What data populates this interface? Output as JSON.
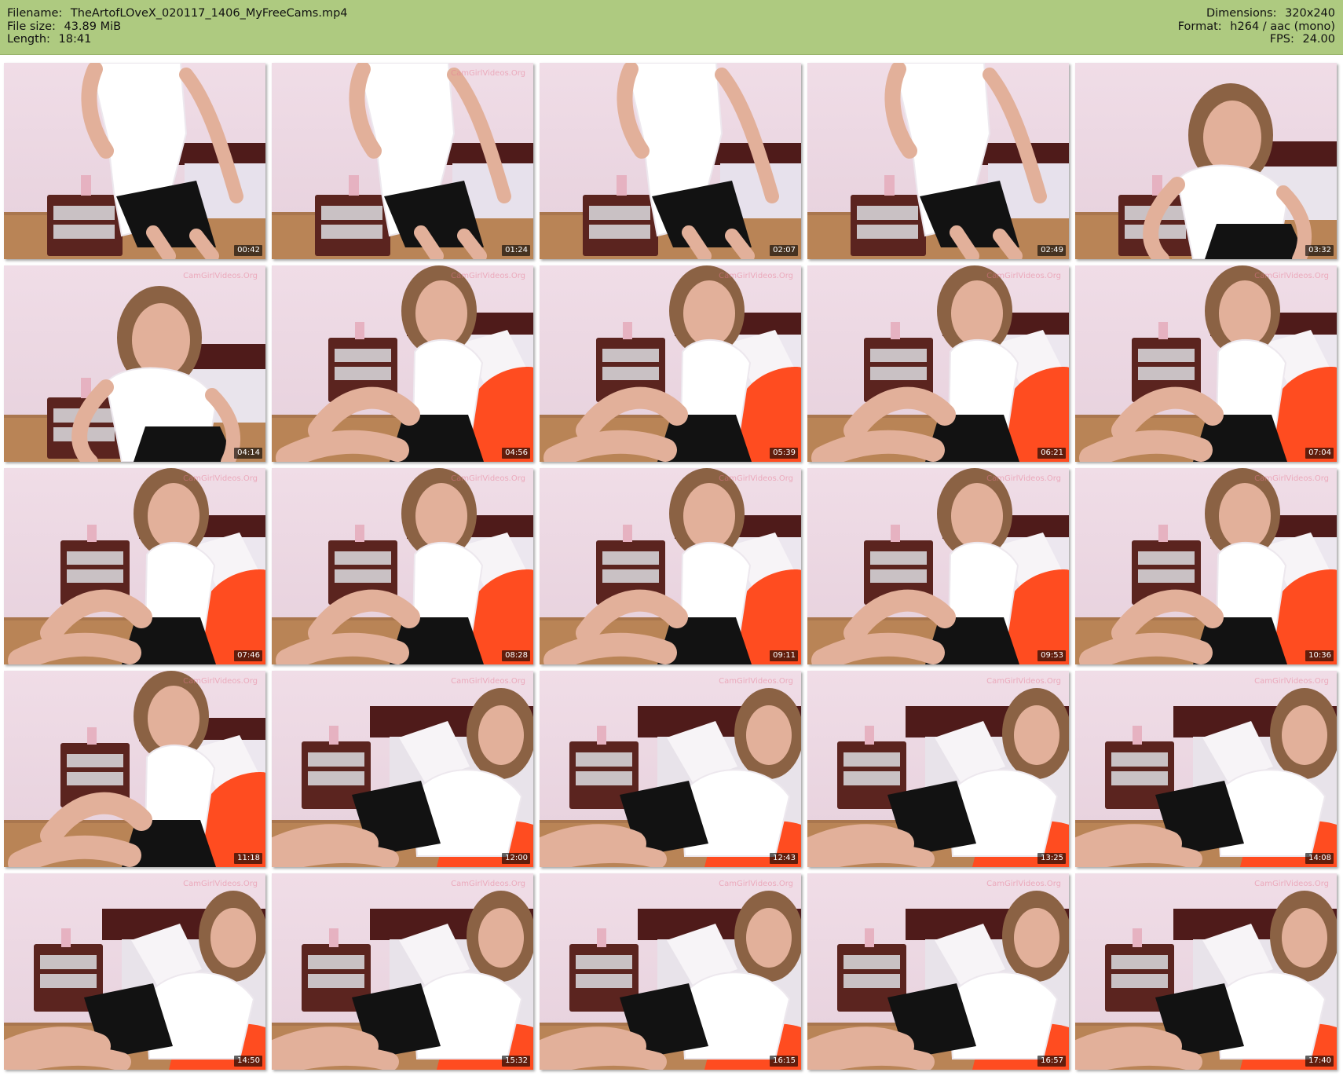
{
  "header": {
    "filename_label": "Filename:",
    "filename": "TheArtofLOveX_020117_1406_MyFreeCams.mp4",
    "filesize_label": "File size:",
    "filesize": "43.89 MiB",
    "length_label": "Length:",
    "length": "18:41",
    "dimensions_label": "Dimensions:",
    "dimensions": "320x240",
    "format_label": "Format:",
    "format": "h264 / aac (mono)",
    "fps_label": "FPS:",
    "fps": "24.00"
  },
  "thumbnails": [
    {
      "timestamp": "00:42",
      "watermark": "",
      "variant": "standing"
    },
    {
      "timestamp": "01:24",
      "watermark": "CamGirlVideos.Org",
      "variant": "standing"
    },
    {
      "timestamp": "02:07",
      "watermark": "",
      "variant": "standing"
    },
    {
      "timestamp": "02:49",
      "watermark": "",
      "variant": "standing"
    },
    {
      "timestamp": "03:32",
      "watermark": "",
      "variant": "leaning"
    },
    {
      "timestamp": "04:14",
      "watermark": "CamGirlVideos.Org",
      "variant": "leaning"
    },
    {
      "timestamp": "04:56",
      "watermark": "CamGirlVideos.Org",
      "variant": "sitting"
    },
    {
      "timestamp": "05:39",
      "watermark": "CamGirlVideos.Org",
      "variant": "sitting"
    },
    {
      "timestamp": "06:21",
      "watermark": "CamGirlVideos.Org",
      "variant": "sitting"
    },
    {
      "timestamp": "07:04",
      "watermark": "CamGirlVideos.Org",
      "variant": "sitting"
    },
    {
      "timestamp": "07:46",
      "watermark": "CamGirlVideos.Org",
      "variant": "sitting"
    },
    {
      "timestamp": "08:28",
      "watermark": "CamGirlVideos.Org",
      "variant": "sitting"
    },
    {
      "timestamp": "09:11",
      "watermark": "CamGirlVideos.Org",
      "variant": "sitting"
    },
    {
      "timestamp": "09:53",
      "watermark": "CamGirlVideos.Org",
      "variant": "sitting"
    },
    {
      "timestamp": "10:36",
      "watermark": "CamGirlVideos.Org",
      "variant": "sitting"
    },
    {
      "timestamp": "11:18",
      "watermark": "CamGirlVideos.Org",
      "variant": "sitting"
    },
    {
      "timestamp": "12:00",
      "watermark": "CamGirlVideos.Org",
      "variant": "lying"
    },
    {
      "timestamp": "12:43",
      "watermark": "CamGirlVideos.Org",
      "variant": "lying"
    },
    {
      "timestamp": "13:25",
      "watermark": "CamGirlVideos.Org",
      "variant": "lying"
    },
    {
      "timestamp": "14:08",
      "watermark": "CamGirlVideos.Org",
      "variant": "lying"
    },
    {
      "timestamp": "14:50",
      "watermark": "CamGirlVideos.Org",
      "variant": "lying"
    },
    {
      "timestamp": "15:32",
      "watermark": "CamGirlVideos.Org",
      "variant": "lying"
    },
    {
      "timestamp": "16:15",
      "watermark": "CamGirlVideos.Org",
      "variant": "lying"
    },
    {
      "timestamp": "16:57",
      "watermark": "CamGirlVideos.Org",
      "variant": "lying"
    },
    {
      "timestamp": "17:40",
      "watermark": "CamGirlVideos.Org",
      "variant": "lying"
    }
  ],
  "colors": {
    "header_bg": "#aeca80",
    "wall": "#e6d0dc",
    "floor": "#b98456",
    "nightstand": "#5b241f",
    "headboard": "#4f1b1a",
    "skin": "#e2b09a",
    "top": "#ffffff",
    "skirt": "#121212",
    "hair": "#8b6244",
    "pillow": "#f7f4f7",
    "cushion": "#ff4c20"
  }
}
